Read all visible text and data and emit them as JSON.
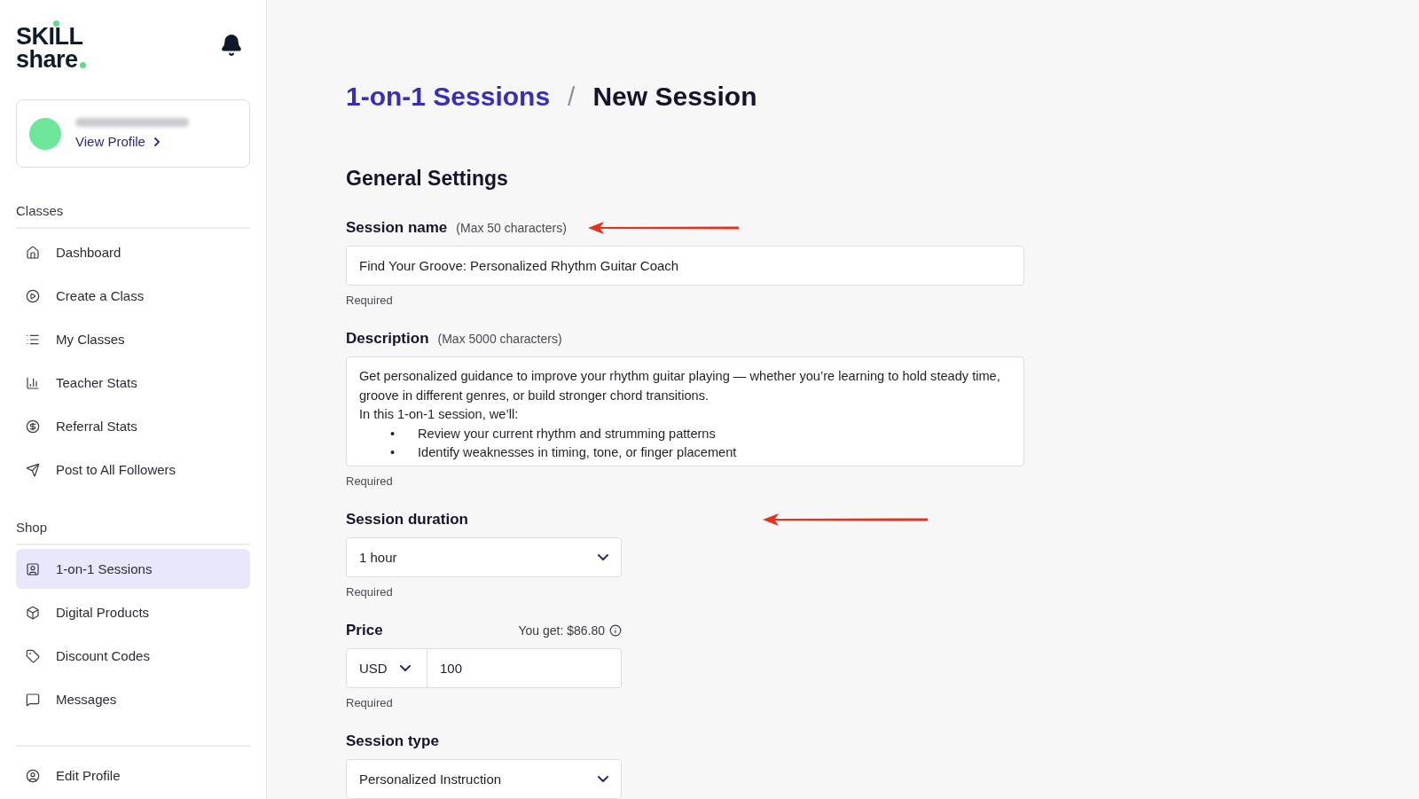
{
  "sidebar": {
    "logo": {
      "line_1": "SKILL",
      "line_2": "share"
    },
    "profile": {
      "link": "View Profile"
    },
    "sections": [
      {
        "title": "Classes",
        "items": [
          {
            "label": "Dashboard",
            "selected": false
          },
          {
            "label": "Create a Class",
            "selected": false
          },
          {
            "label": "My Classes",
            "selected": false
          },
          {
            "label": "Teacher Stats",
            "selected": false
          },
          {
            "label": "Referral Stats",
            "selected": false
          },
          {
            "label": "Post to All Followers",
            "selected": false
          }
        ]
      },
      {
        "title": "Shop",
        "items": [
          {
            "label": "1-on-1 Sessions",
            "selected": true
          },
          {
            "label": "Digital Products",
            "selected": false
          },
          {
            "label": "Discount Codes",
            "selected": false
          },
          {
            "label": "Messages",
            "selected": false
          }
        ]
      }
    ],
    "footer_items": [
      {
        "label": "Edit Profile",
        "selected": false
      }
    ]
  },
  "breadcrumb": {
    "items": [
      {
        "kind": "link",
        "text": "1-on-1 Sessions"
      },
      {
        "kind": "current",
        "text": "New Session"
      }
    ],
    "separator": "/"
  },
  "form": {
    "title": "General Settings",
    "fields": [
      {
        "kind": "text",
        "label": "Session name",
        "hint": "(Max 50 characters)",
        "value": "Find Your Groove: Personalized Rhythm Guitar Coach",
        "helper": "Required",
        "annotated": true
      },
      {
        "kind": "textarea",
        "label": "Description",
        "hint": "(Max 5000 characters)",
        "lines": [
          {
            "kind": "text",
            "text": "Get personalized guidance to improve your rhythm guitar playing — whether you’re learning to hold steady time, groove in different genres, or build stronger chord transitions."
          },
          {
            "kind": "text",
            "text": "In this 1-on-1 session, we’ll:"
          },
          {
            "kind": "bullet",
            "marker": "•",
            "text": "Review your current rhythm and strumming patterns"
          },
          {
            "kind": "bullet",
            "marker": "•",
            "text": "Identify weaknesses in timing, tone, or finger placement"
          }
        ],
        "helper": "Required",
        "annotated": false
      },
      {
        "kind": "select",
        "label": "Session duration",
        "value": "1 hour",
        "helper": "Required",
        "annotated": true
      },
      {
        "kind": "price",
        "label": "Price",
        "earnings": "You get: $86.80",
        "currency": "USD",
        "value": "100",
        "helper": "Required",
        "annotated": false
      },
      {
        "kind": "select",
        "label": "Session type",
        "value": "Personalized Instruction",
        "annotated": false
      }
    ]
  }
}
